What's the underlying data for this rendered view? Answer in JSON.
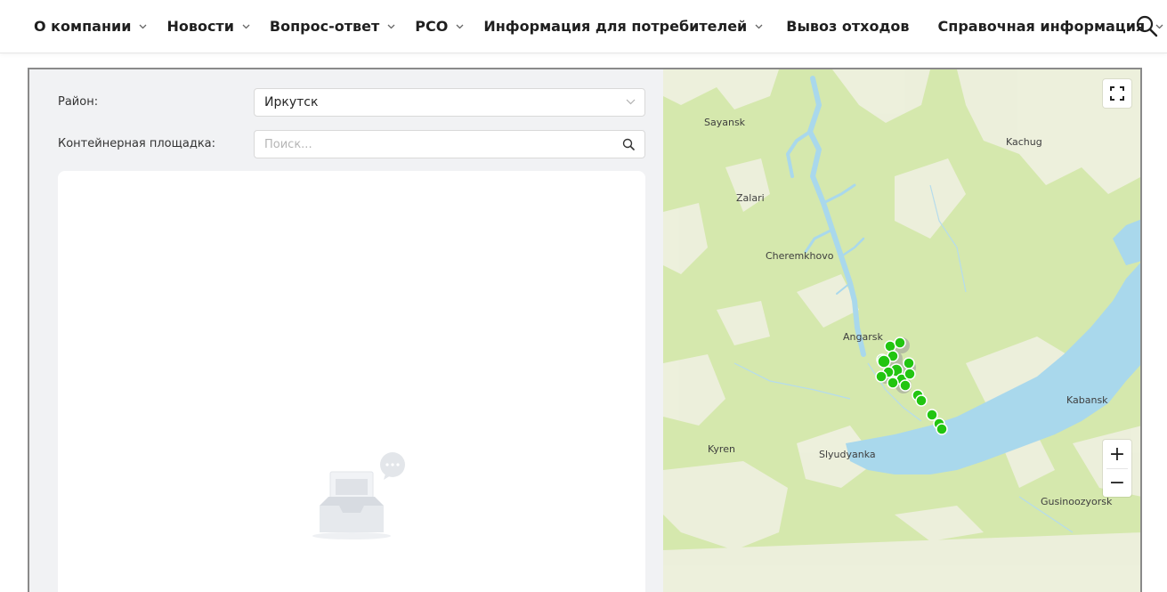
{
  "nav": {
    "items": [
      {
        "label": "О компании",
        "has_dropdown": true
      },
      {
        "label": "Новости",
        "has_dropdown": true
      },
      {
        "label": "Вопрос-ответ",
        "has_dropdown": true
      },
      {
        "label": "РСО",
        "has_dropdown": true
      },
      {
        "label": "Информация для потребителей",
        "has_dropdown": true
      },
      {
        "label": "Вывоз отходов",
        "has_dropdown": false
      },
      {
        "label": "Справочная информация",
        "has_dropdown": true
      }
    ],
    "search_icon": "search-icon"
  },
  "filters": {
    "district_label": "Район:",
    "district_value": "Иркутск",
    "site_label": "Контейнерная площадка:",
    "site_placeholder": "Поиск..."
  },
  "list": {
    "empty_icon": "empty-inbox-icon"
  },
  "map": {
    "labels": {
      "sayansk": "Sayansk",
      "kachug": "Kachug",
      "zalari": "Zalari",
      "cheremkhovo": "Cheremkhovo",
      "angarsk": "Angarsk",
      "kabansk": "Kabansk",
      "kyren": "Kyren",
      "slyudyanka": "Slyudyanka",
      "gusinoozyorsk": "Gusinoozyorsk"
    },
    "controls": {
      "fullscreen_icon": "fullscreen-icon",
      "zoom_in": "+",
      "zoom_out": "−"
    },
    "colors": {
      "land": "#d5e8ad",
      "forest": "#eef0de",
      "water": "#a9d8ec",
      "marker": "#22c511"
    }
  }
}
